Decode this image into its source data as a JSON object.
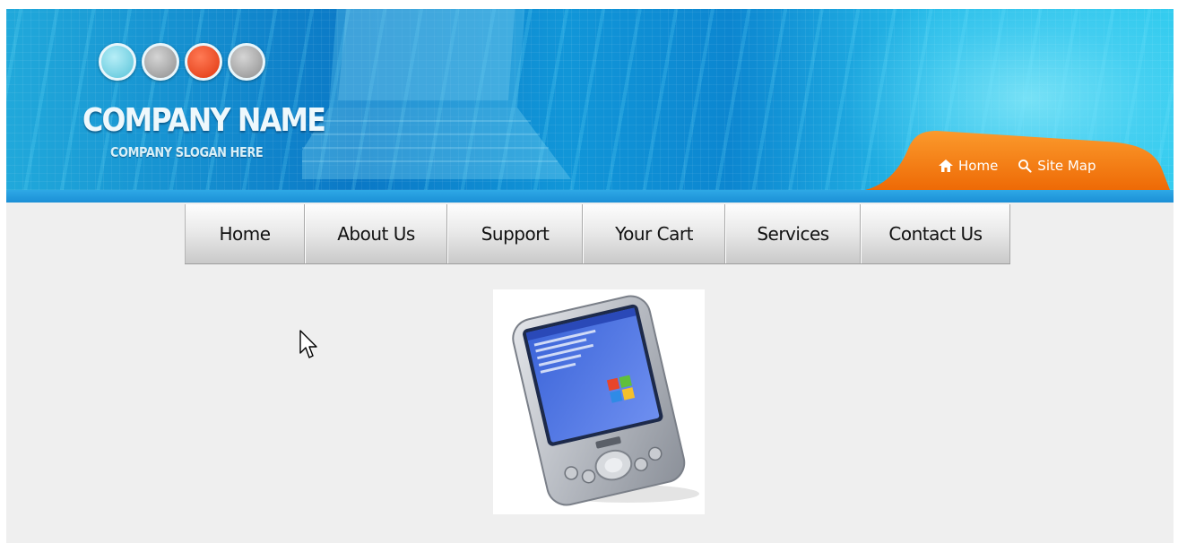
{
  "header": {
    "company_name": "COMPANY NAME",
    "company_slogan": "COMPANY SLOGAN HERE",
    "logo_circle_colors": [
      "#58c3d9",
      "#8e8e8e",
      "#e0360f",
      "#8e8e8e"
    ],
    "top_links": [
      {
        "label": "Home",
        "icon": "house-icon"
      },
      {
        "label": "Site Map",
        "icon": "magnifier-icon"
      }
    ],
    "accent_color": "#f27a0c"
  },
  "nav": {
    "items": [
      {
        "label": "Home"
      },
      {
        "label": "About Us"
      },
      {
        "label": "Support"
      },
      {
        "label": "Your Cart"
      },
      {
        "label": "Services"
      },
      {
        "label": "Contact Us"
      }
    ]
  },
  "main": {
    "product_image": "pocket-pc-pda"
  }
}
